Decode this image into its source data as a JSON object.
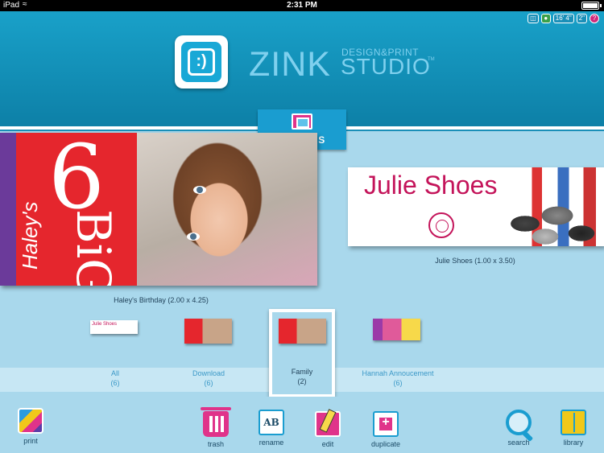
{
  "status_bar": {
    "device": "iPad",
    "time": "2:31 PM"
  },
  "header": {
    "brand_zink": "ZINK",
    "brand_design_print": "DESIGN&PRINT",
    "brand_studio": "STUDIO",
    "brand_tm": "TM",
    "logo_face": ":)",
    "top_icons": {
      "paper_length": "16' 4\"",
      "zoom_value": "2\"",
      "help": "?"
    }
  },
  "designs_tab": {
    "label": "DESIGNS"
  },
  "designs": [
    {
      "caption": "Haley's Birthday (2.00 x 4.25)",
      "card_text": {
        "haleys": "Haley's",
        "big": "BiG",
        "six": "6"
      }
    },
    {
      "caption": "Julie Shoes (1.00 x 3.50)",
      "card_text": {
        "title": "Julie Shoes"
      }
    }
  ],
  "collections": [
    {
      "name": "All",
      "count": "(6)",
      "thumb_text": "Julie Shoes"
    },
    {
      "name": "Download",
      "count": "(6)"
    },
    {
      "name": "Family",
      "count": "(2)",
      "selected": true
    },
    {
      "name": "Hannah Annoucement",
      "count": "(6)"
    }
  ],
  "toolbar": {
    "print_label": "print",
    "trash_label": "trash",
    "rename_label": "rename",
    "rename_glyph": "AB",
    "edit_label": "edit",
    "duplicate_label": "duplicate",
    "search_label": "search",
    "library_label": "library"
  },
  "colors": {
    "header_blue": "#0d7fa6",
    "accent_pink": "#e0338a",
    "background": "#a9d8ec"
  }
}
